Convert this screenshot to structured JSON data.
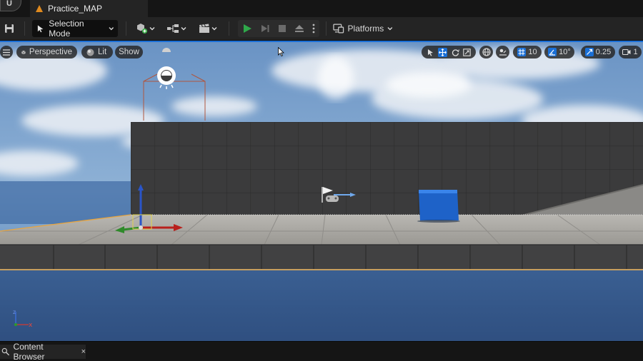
{
  "title_bar": {
    "logo_glyph": "U",
    "level_tab": "Practice_MAP"
  },
  "toolbar": {
    "save_icon": "save-icon",
    "selection_mode": "Selection Mode",
    "platforms": "Platforms",
    "accent": "#2fa84a"
  },
  "viewport": {
    "view_type": "Perspective",
    "view_mode": "Lit",
    "show": "Show",
    "grid_snap": "10",
    "rotation_snap": "10°",
    "scale_snap": "0.25",
    "camera_speed": "1",
    "accent": "#1a6fd6"
  },
  "bottom_bar": {
    "content_browser": "Content Browser",
    "close": "×"
  }
}
